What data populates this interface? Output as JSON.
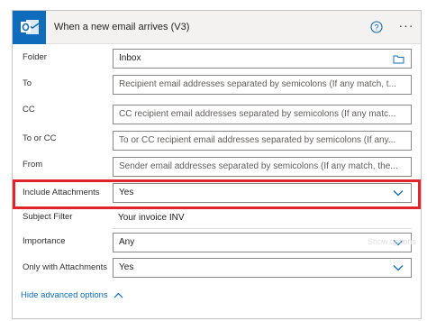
{
  "header": {
    "title": "When a new email arrives (V3)",
    "app_icon": "outlook-icon",
    "help_icon": "help-circle-icon",
    "more_label": "···"
  },
  "fields": [
    {
      "label": "Folder",
      "value": "Inbox",
      "kind": "value",
      "icon": "folder-icon"
    },
    {
      "label": "To",
      "placeholder": "Recipient email addresses separated by semicolons (If any match, t..."
    },
    {
      "label": "CC",
      "placeholder": "CC recipient email addresses separated by semicolons (If any matc..."
    },
    {
      "label": "To or CC",
      "placeholder": "To or CC recipient email addresses separated by semicolons (If any..."
    },
    {
      "label": "From",
      "placeholder": "Sender email addresses separated by semicolons (If any match, the..."
    },
    {
      "label": "Include Attachments",
      "value": "Yes",
      "kind": "dropdown"
    },
    {
      "label": "Subject Filter",
      "value": "Your invoice INV",
      "kind": "text"
    },
    {
      "label": "Importance",
      "value": "Any",
      "kind": "dropdown"
    },
    {
      "label": "Only with Attachments",
      "value": "Yes",
      "kind": "dropdown"
    }
  ],
  "ghost_text": "Show options",
  "advanced_toggle": "Hide advanced options",
  "colors": {
    "accent": "#0f6cbd",
    "highlight": "#e0242b"
  }
}
